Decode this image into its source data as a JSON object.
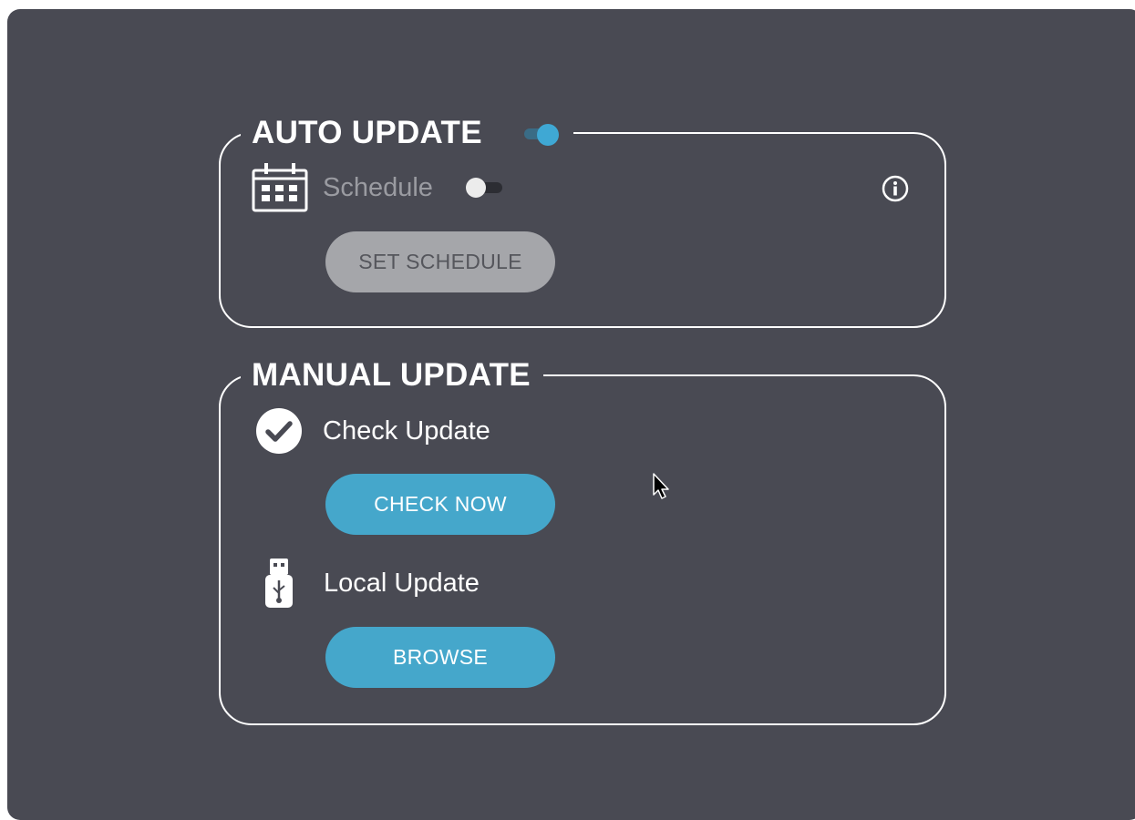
{
  "auto_update": {
    "title": "AUTO UPDATE",
    "enabled": true,
    "schedule_label": "Schedule",
    "schedule_enabled": false,
    "set_schedule_button": "SET SCHEDULE",
    "icons": {
      "calendar": "calendar-icon",
      "info": "info-icon",
      "toggle": "toggle-switch"
    }
  },
  "manual_update": {
    "title": "MANUAL UPDATE",
    "check_update_label": "Check Update",
    "check_now_button": "CHECK NOW",
    "local_update_label": "Local Update",
    "browse_button": "BROWSE",
    "icons": {
      "check": "check-circle-icon",
      "usb": "usb-drive-icon"
    }
  },
  "colors": {
    "background": "#494a53",
    "accent": "#45a7cb",
    "disabled_button": "#a5a6aa",
    "border": "#ffffff"
  }
}
